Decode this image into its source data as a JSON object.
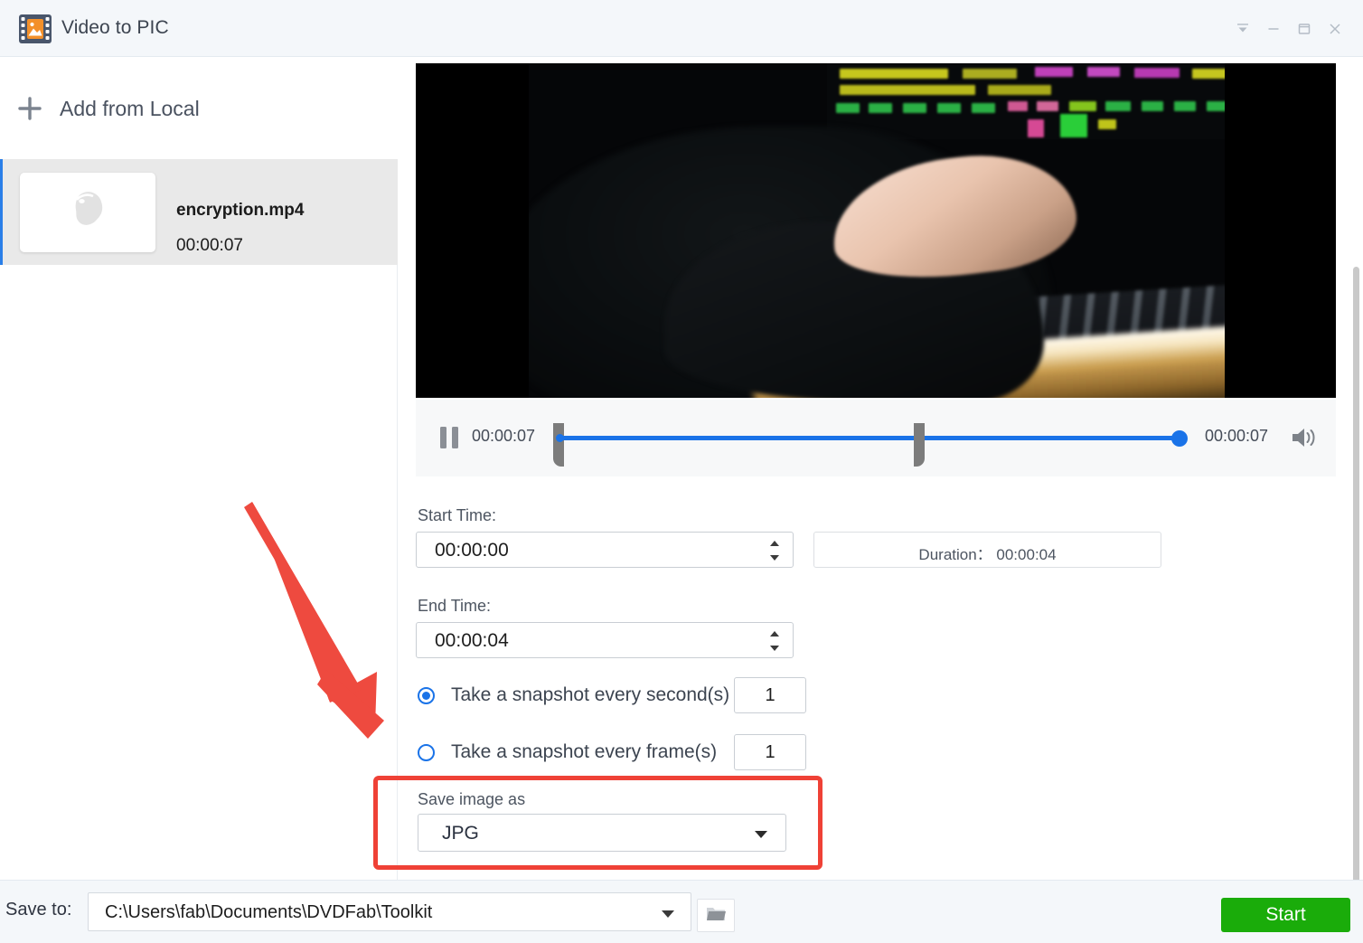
{
  "window": {
    "title": "Video to PIC",
    "app_icon": "film-image-icon",
    "controls": [
      {
        "name": "collapse-button",
        "icon": "double-chevron-down-icon"
      },
      {
        "name": "minimize-button",
        "icon": "minimize-icon"
      },
      {
        "name": "maximize-button",
        "icon": "maximize-icon"
      },
      {
        "name": "close-button",
        "icon": "close-icon"
      }
    ]
  },
  "sidebar": {
    "add_from_local": "Add from Local",
    "add_icon": "plus-icon",
    "files": [
      {
        "name": "encryption.mp4",
        "duration": "00:00:07",
        "thumbnail_icon": "image-placeholder-icon",
        "selected": true
      }
    ]
  },
  "player": {
    "pause_icon": "pause-icon",
    "current_time": "00:00:07",
    "total_time": "00:00:07",
    "volume_icon": "speaker-icon",
    "progress_percent": 100,
    "trim_start_percent": 0,
    "trim_end_percent": 57
  },
  "form": {
    "start_time_label": "Start Time:",
    "start_time_value": "00:00:00",
    "duration_text": "Duration： 00:00:04",
    "end_time_label": "End Time:",
    "end_time_value": "00:00:04",
    "snapshot_second": {
      "label": "Take a snapshot every second(s)",
      "value": "1",
      "selected": true
    },
    "snapshot_frame": {
      "label": "Take a snapshot every frame(s)",
      "value": "1",
      "selected": false
    },
    "save_image_as_label": "Save image as",
    "save_image_as_value": "JPG"
  },
  "bottom": {
    "save_to_label": "Save to:",
    "save_to_path": "C:\\Users\\fab\\Documents\\DVDFab\\Toolkit",
    "browse_icon": "folder-icon",
    "start_label": "Start"
  },
  "annotations": {
    "arrow_color": "#ee4a3f",
    "highlight_color": "#ef4136"
  },
  "colors": {
    "accent_blue": "#1a73e8",
    "start_green": "#1aac0a",
    "titlebar_bg": "#f4f7fa",
    "selected_row_bg": "#e9e9e9"
  }
}
